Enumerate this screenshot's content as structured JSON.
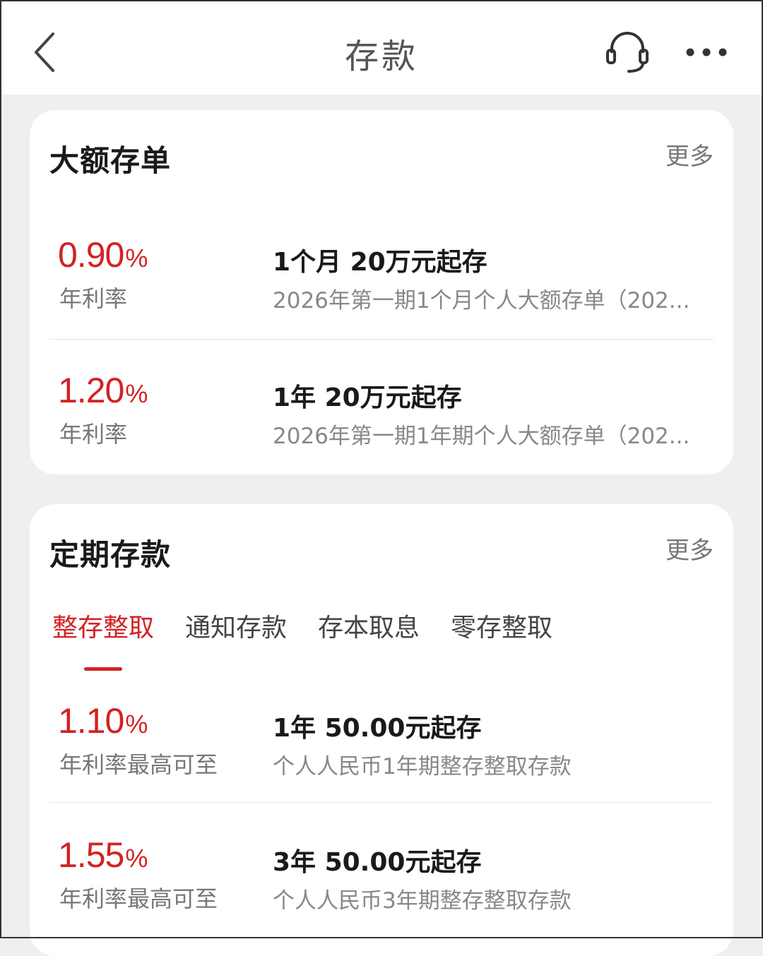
{
  "nav": {
    "title": "存款",
    "icons": [
      "back-chevron-icon",
      "headset-icon",
      "more-dots-icon"
    ]
  },
  "large_cd": {
    "title": "大额存单",
    "more": "更多",
    "items": [
      {
        "rate": "0.90",
        "unit": "%",
        "rate_label": "年利率",
        "title": "1个月 20万元起存",
        "desc": "2026年第一期1个月个人大额存单（202..."
      },
      {
        "rate": "1.20",
        "unit": "%",
        "rate_label": "年利率",
        "title": "1年 20万元起存",
        "desc": "2026年第一期1年期个人大额存单（202..."
      }
    ]
  },
  "fixed": {
    "title": "定期存款",
    "more": "更多",
    "tabs": [
      "整存整取",
      "通知存款",
      "存本取息",
      "零存整取"
    ],
    "active_tab": 0,
    "items": [
      {
        "rate": "1.10",
        "unit": "%",
        "rate_label": "年利率最高可至",
        "title": "1年 50.00元起存",
        "desc": "个人人民币1年期整存整取存款"
      },
      {
        "rate": "1.55",
        "unit": "%",
        "rate_label": "年利率最高可至",
        "title": "3年 50.00元起存",
        "desc": "个人人民币3年期整存整取存款"
      }
    ]
  },
  "colors": {
    "accent": "#d32222",
    "background": "#eeeff1"
  }
}
